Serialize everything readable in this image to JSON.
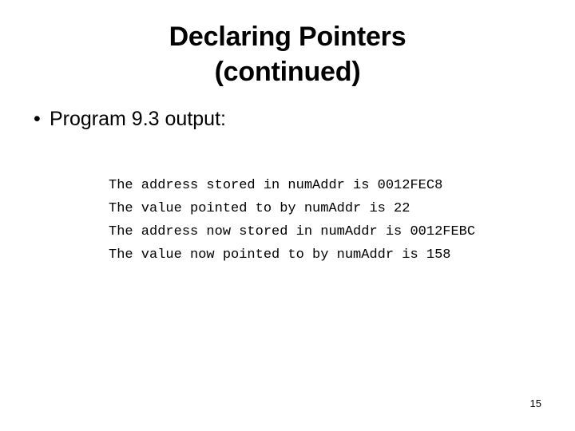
{
  "slide": {
    "title_lines": [
      "Declaring Pointers",
      "(continued)"
    ],
    "bullets": [
      {
        "marker": "•",
        "text": "Program 9.3 output:"
      }
    ],
    "output": {
      "lines": [
        "The address stored in numAddr is 0012FEC8",
        "The value pointed to by numAddr is 22",
        "The address now stored in numAddr is 0012FEBC",
        "The value now pointed to by numAddr is 158"
      ]
    },
    "page_number": "15",
    "colors": {
      "background": "#ffffff",
      "text": "#000000"
    }
  }
}
